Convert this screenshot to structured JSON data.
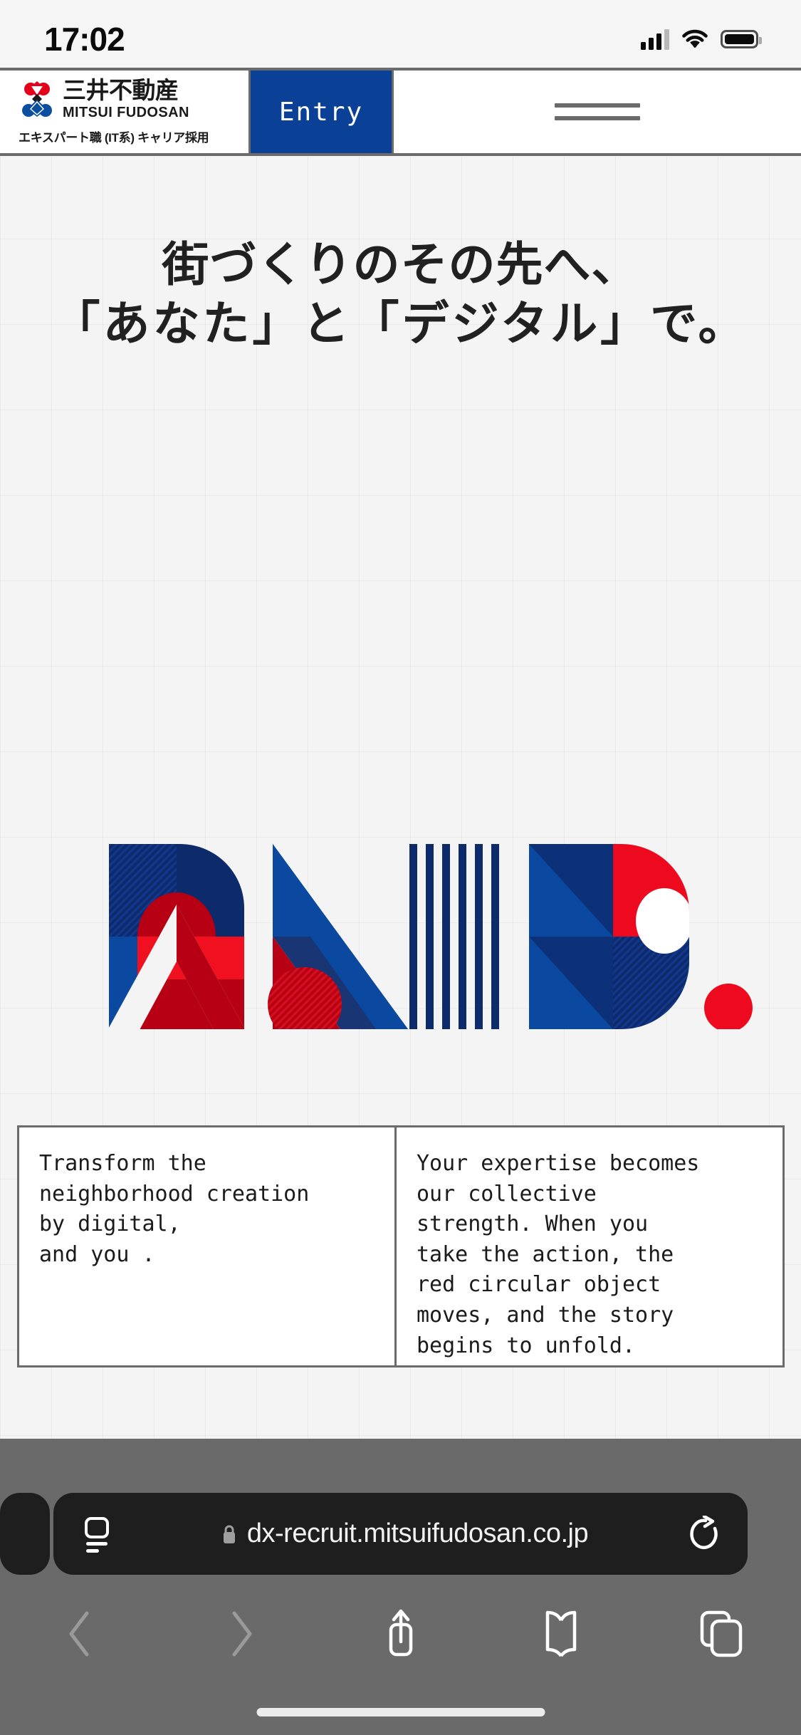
{
  "status_bar": {
    "time": "17:02",
    "cellular_icon": "signal-bars-icon",
    "wifi_icon": "wifi-icon",
    "battery_icon": "battery-icon"
  },
  "site_header": {
    "logo_icon": "mitsui-fudosan-logo-icon",
    "logo_jp": "三井不動産",
    "logo_en": "MITSUI FUDOSAN",
    "logo_subtitle": "エキスパート職 (IT系) キャリア採用",
    "entry_label": "Entry",
    "menu_icon": "hamburger-menu-icon",
    "entry_bg": "#0a4196",
    "border_color": "#6b6b6b"
  },
  "hero": {
    "heading_line1": "街づくりのその先へ、",
    "heading_line2": "「あなた」と「デジタル」で。",
    "graphic_name": "and-period-logotype",
    "graphic_colors": {
      "navy": "#0d2a6b",
      "blue": "#0b48a0",
      "red": "#e60019",
      "dark_red": "#b70014",
      "white": "#ffffff"
    }
  },
  "captions": {
    "left": "Transform the\nneighborhood creation\nby digital,\nand you .",
    "right": "Your expertise becomes\nour collective\nstrength. When you\ntake the action, the\nred circular object\nmoves, and the story\nbegins to unfold."
  },
  "browser": {
    "aa_icon": "page-settings-icon",
    "lock_icon": "lock-icon",
    "url": "dx-recruit.mitsuifudosan.co.jp",
    "reload_icon": "reload-icon",
    "toolbar": [
      {
        "name": "back-button",
        "icon": "chevron-left-icon",
        "enabled": false
      },
      {
        "name": "forward-button",
        "icon": "chevron-right-icon",
        "enabled": false
      },
      {
        "name": "share-button",
        "icon": "share-icon",
        "enabled": true
      },
      {
        "name": "bookmarks-button",
        "icon": "book-icon",
        "enabled": true
      },
      {
        "name": "tabs-button",
        "icon": "tabs-icon",
        "enabled": true
      }
    ],
    "chrome_bg": "#6a6a6a",
    "urlbar_bg": "#1e1e1e"
  }
}
